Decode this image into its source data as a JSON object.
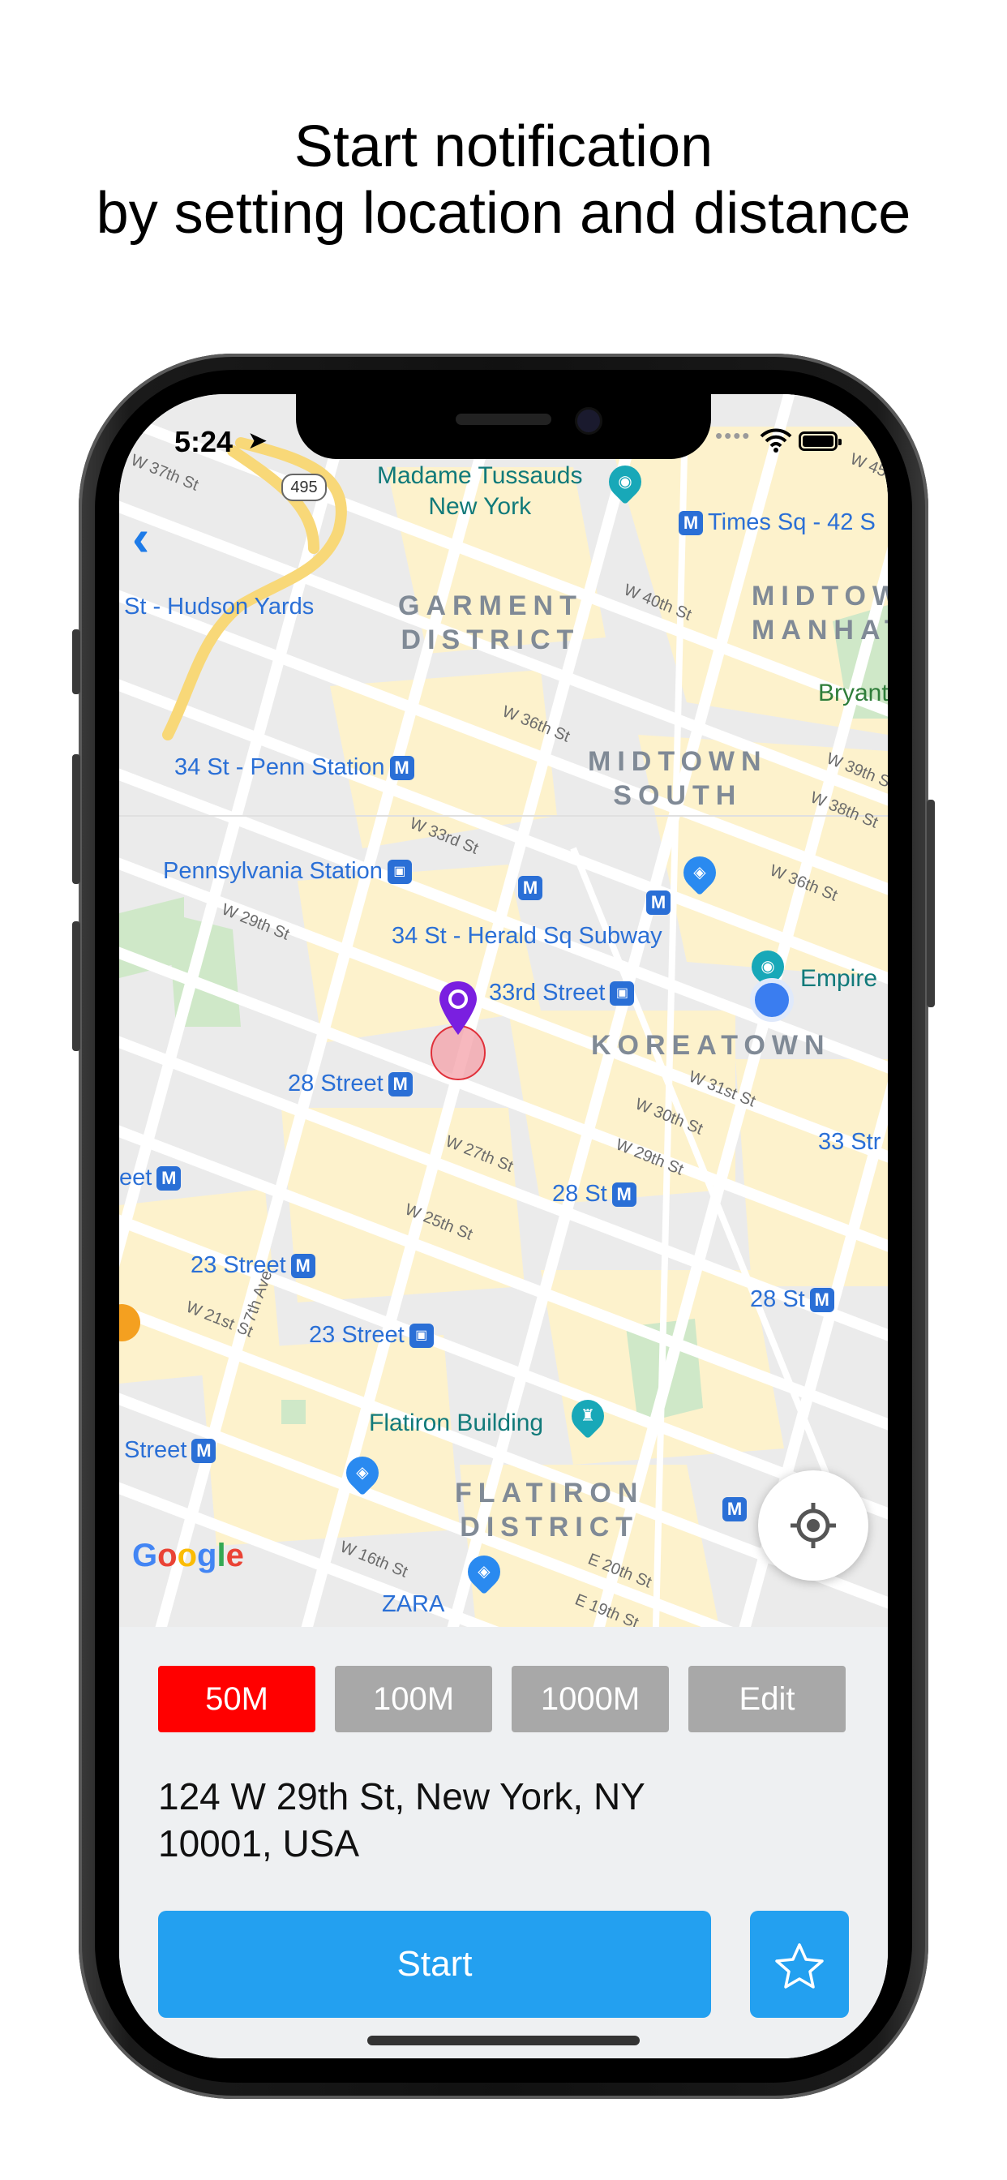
{
  "headline": {
    "line1": "Start notification",
    "line2": "by setting location and distance"
  },
  "status_bar": {
    "time": "5:24",
    "location_icon": "location-arrow-icon",
    "wifi_icon": "wifi-icon",
    "battery_icon": "battery-icon"
  },
  "map": {
    "labels": {
      "madame_tussauds": "Madame Tussauds\nNew York",
      "times_sq": "Times Sq - 42 S",
      "midtown_manhattan": "MIDTOW\nMANHAT",
      "hudson_yards": "St - Hudson Yards",
      "garment_district": "GARMENT\nDISTRICT",
      "bryant": "Bryant",
      "penn_station_34": "34 St - Penn Station",
      "midtown_south": "MIDTOWN\nSOUTH",
      "pennsylvania_station": "Pennsylvania Station",
      "herald_sq": "34 St - Herald Sq Subway",
      "empire": "Empire",
      "street_33rd": "33rd Street",
      "koreatown": "KOREATOWN",
      "street_28_left": "28 Street",
      "street_33_right": "33 Str",
      "eet": "eet",
      "st_28_center": "28 St",
      "street_23_a": "23 Street",
      "st_28_right": "28 St",
      "street_23_b": "23 Street",
      "flatiron_building": "Flatiron Building",
      "street_left_bottom": "Street",
      "flatiron_district": "FLATIRON\nDISTRICT",
      "zara": "ZARA",
      "route_495": "495",
      "seventh_ave": "7th Ave",
      "w37": "W 37th St",
      "w40": "W 40th St",
      "w36": "W 36th St",
      "w39": "W 39th St",
      "w38": "W 38th St",
      "w36b": "W 36th St",
      "w33": "W 33rd St",
      "w29": "W 29th St",
      "w31": "W 31st St",
      "w30": "W 30th St",
      "w29b": "W 29th St",
      "w27": "W 27th St",
      "w25": "W 25th St",
      "w21": "W 21st St",
      "w16": "W 16th St",
      "e20": "E 20th St",
      "e19": "E 19th St",
      "w45": "W 45th",
      "w3": "W 3"
    },
    "google_logo": "Google"
  },
  "distance_options": [
    {
      "label": "50M",
      "selected": true
    },
    {
      "label": "100M",
      "selected": false
    },
    {
      "label": "1000M",
      "selected": false
    },
    {
      "label": "Edit",
      "selected": false
    }
  ],
  "address": {
    "line1": "124 W 29th St, New York, NY",
    "line2": "10001, USA"
  },
  "start_button": "Start",
  "favorite_icon": "star-outline-icon",
  "colors": {
    "accent": "#23a0f0",
    "selected": "#ff0000",
    "unselected": "#a8a8a8",
    "pin": "#7a1fe0",
    "circle": "#f4a0a8"
  }
}
